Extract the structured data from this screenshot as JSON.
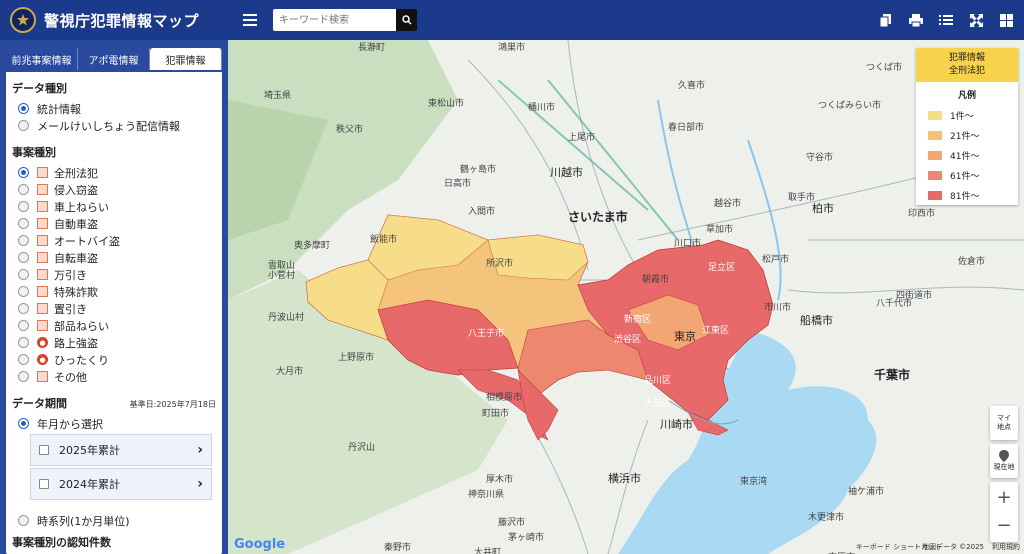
{
  "header": {
    "title": "警視庁犯罪情報マップ",
    "search_placeholder": "キーワード検索",
    "icons": [
      "copy-icon",
      "print-icon",
      "list-icon",
      "fullscreen-icon",
      "grid-icon"
    ]
  },
  "sidebar": {
    "tabs": [
      {
        "label": "前兆事案情報"
      },
      {
        "label": "アポ電情報"
      },
      {
        "label": "犯罪情報"
      }
    ],
    "data_type_title": "データ種別",
    "data_types": [
      {
        "label": "統計情報",
        "selected": true
      },
      {
        "label": "メールけいしちょう配信情報",
        "selected": false
      }
    ],
    "case_type_title": "事案種別",
    "case_types": [
      {
        "label": "全刑法犯",
        "selected": true
      },
      {
        "label": "侵入窃盗",
        "selected": false
      },
      {
        "label": "車上ねらい",
        "selected": false
      },
      {
        "label": "自動車盗",
        "selected": false
      },
      {
        "label": "オートバイ盗",
        "selected": false
      },
      {
        "label": "自転車盗",
        "selected": false
      },
      {
        "label": "万引き",
        "selected": false
      },
      {
        "label": "特殊詐欺",
        "selected": false
      },
      {
        "label": "置引き",
        "selected": false
      },
      {
        "label": "部品ねらい",
        "selected": false
      },
      {
        "label": "路上強盗",
        "selected": false
      },
      {
        "label": "ひったくり",
        "selected": false
      },
      {
        "label": "その他",
        "selected": false
      }
    ],
    "period_title": "データ期間",
    "base_date": "基準日:2025年7月18日",
    "select_by_month": "年月から選択",
    "years": [
      {
        "label": "2025年累計"
      },
      {
        "label": "2024年累計"
      }
    ],
    "time_series": "時系列(1か月単位)",
    "count_title": "事案種別の認知件数"
  },
  "legend": {
    "header_line1": "犯罪情報",
    "header_line2": "全刑法犯",
    "subtitle": "凡例",
    "items": [
      {
        "label": "1件～",
        "color": "#f7dc8a"
      },
      {
        "label": "21件～",
        "color": "#f5c177"
      },
      {
        "label": "41件～",
        "color": "#f3a673"
      },
      {
        "label": "61件～",
        "color": "#ee8770"
      },
      {
        "label": "81件～",
        "color": "#e8696a"
      }
    ]
  },
  "map": {
    "my_location": "マイ地点",
    "current_location": "現在地",
    "zoom_in": "+",
    "zoom_out": "−",
    "google": "Google",
    "shortcuts": "キーボード ショートカット",
    "map_data": "地図データ ©2025",
    "terms": "利用規約",
    "places": [
      {
        "name": "埼玉県"
      },
      {
        "name": "さいたま市"
      },
      {
        "name": "川越市"
      },
      {
        "name": "長瀞町"
      },
      {
        "name": "秩父市"
      },
      {
        "name": "東松山市"
      },
      {
        "name": "鴻巣市"
      },
      {
        "name": "桶川市"
      },
      {
        "name": "上尾市"
      },
      {
        "name": "久喜市"
      },
      {
        "name": "春日部市"
      },
      {
        "name": "つくば市"
      },
      {
        "name": "つくばみらい市"
      },
      {
        "name": "守谷市"
      },
      {
        "name": "取手市"
      },
      {
        "name": "柏市"
      },
      {
        "name": "松戸市"
      },
      {
        "name": "市川市"
      },
      {
        "name": "船橋市"
      },
      {
        "name": "八千代市"
      },
      {
        "name": "千葉市"
      },
      {
        "name": "四街道市"
      },
      {
        "name": "佐倉市"
      },
      {
        "name": "印西市"
      },
      {
        "name": "川口市"
      },
      {
        "name": "草加市"
      },
      {
        "name": "越谷市"
      },
      {
        "name": "所沢市"
      },
      {
        "name": "飯能市"
      },
      {
        "name": "日高市"
      },
      {
        "name": "鶴ヶ島市"
      },
      {
        "name": "入間市"
      },
      {
        "name": "朝霞市"
      },
      {
        "name": "足立区"
      },
      {
        "name": "江東区"
      },
      {
        "name": "新宿区"
      },
      {
        "name": "渋谷区"
      },
      {
        "name": "品川区"
      },
      {
        "name": "大田区"
      },
      {
        "name": "東京"
      },
      {
        "name": "八王子市"
      },
      {
        "name": "相模原市"
      },
      {
        "name": "町田市"
      },
      {
        "name": "川崎市"
      },
      {
        "name": "横浜市"
      },
      {
        "name": "厚木市"
      },
      {
        "name": "神奈川県"
      },
      {
        "name": "丹沢山"
      },
      {
        "name": "大月市"
      },
      {
        "name": "上野原市"
      },
      {
        "name": "雲取山"
      },
      {
        "name": "小菅村"
      },
      {
        "name": "丹波山村"
      },
      {
        "name": "奥多摩町"
      },
      {
        "name": "東京湾"
      },
      {
        "name": "木更津市"
      },
      {
        "name": "袖ケ浦市"
      },
      {
        "name": "市原市"
      },
      {
        "name": "大井町"
      },
      {
        "name": "秦野市"
      },
      {
        "name": "藤沢市"
      },
      {
        "name": "茅ヶ崎市"
      }
    ]
  }
}
